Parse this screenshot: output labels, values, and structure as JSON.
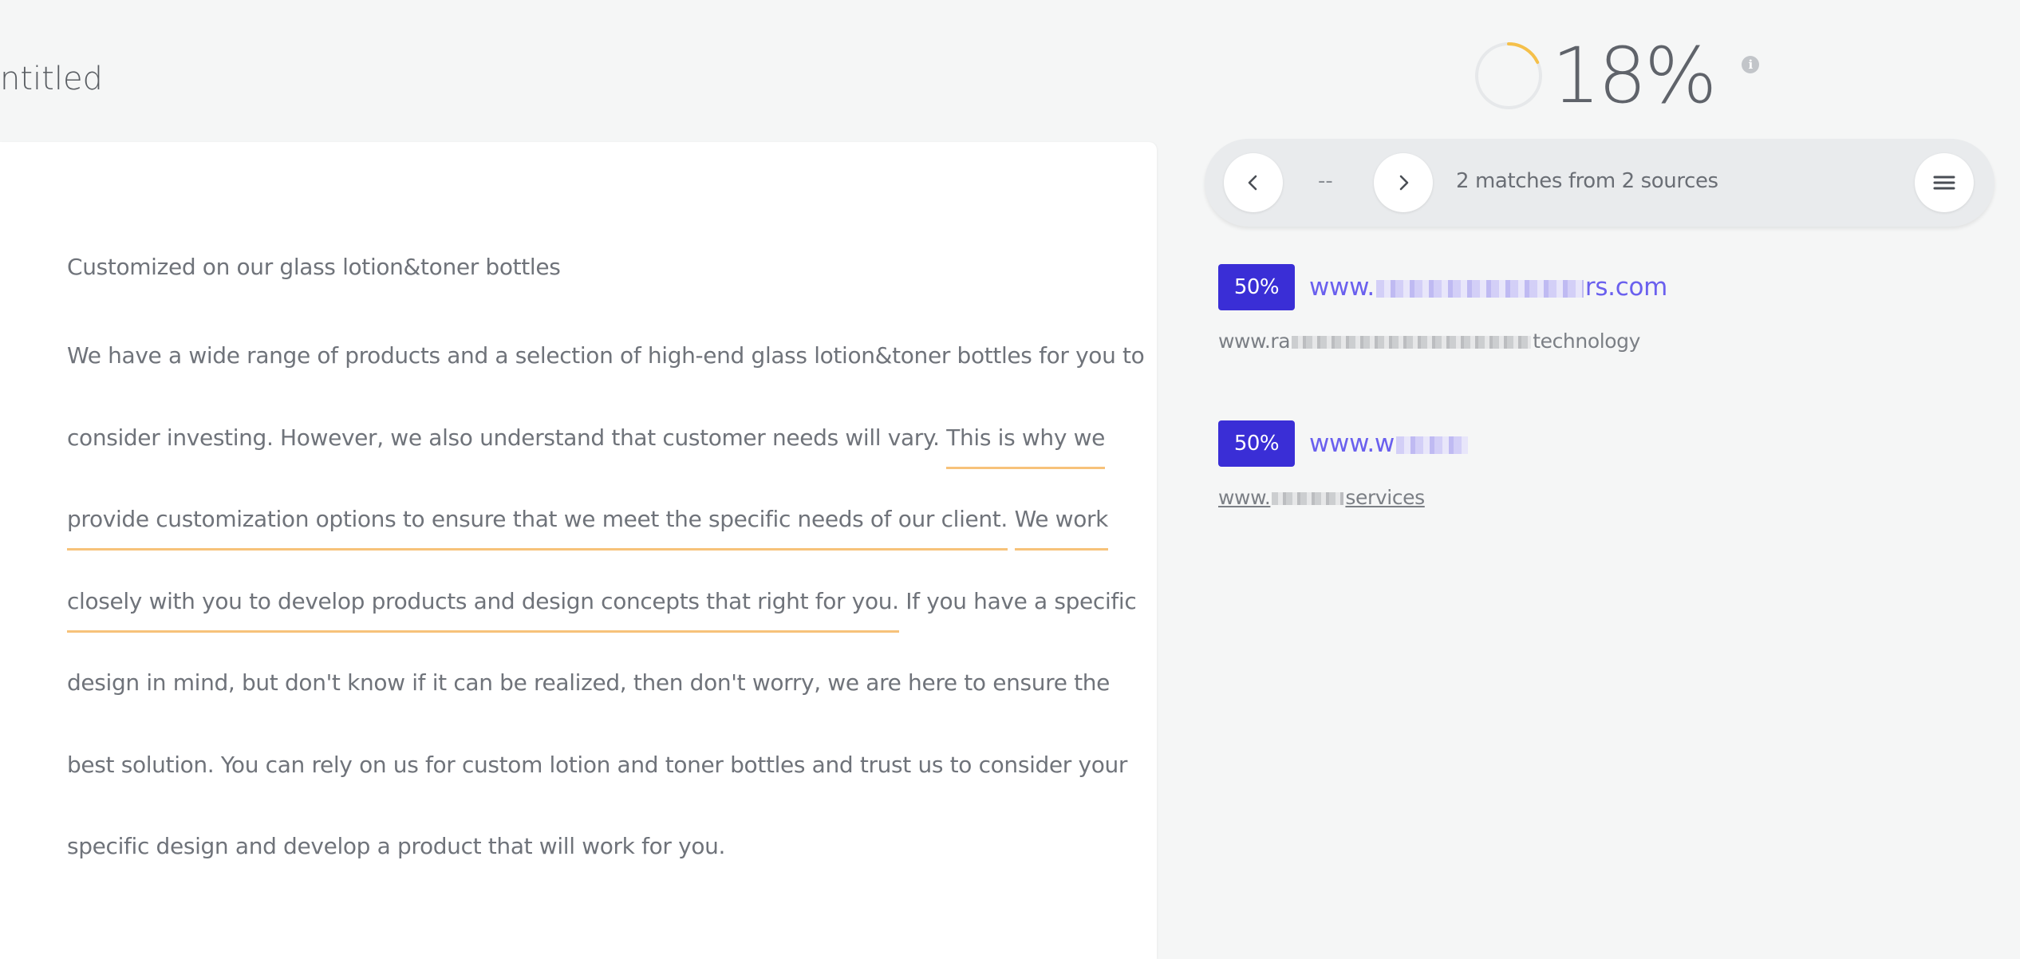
{
  "document": {
    "title": "ntitled",
    "heading": "Customized on our glass lotion&toner bottles",
    "lines": [
      [
        {
          "t": "We have a wide range of products and a selection of high-end glass lotion&toner bottles for you to",
          "hl": false
        }
      ],
      [
        {
          "t": "consider investing. However, we also understand that customer needs will vary. ",
          "hl": false
        },
        {
          "t": "This is why we",
          "hl": true
        }
      ],
      [
        {
          "t": "provide customization options to ensure that we meet the specific needs of our client.",
          "hl": true
        },
        {
          "t": " ",
          "hl": false
        },
        {
          "t": "We work",
          "hl": true
        }
      ],
      [
        {
          "t": "closely with you to develop products and design concepts that right for you.",
          "hl": true
        },
        {
          "t": " If you have a specific",
          "hl": false
        }
      ],
      [
        {
          "t": "design in mind, but don't know if it can be realized, then don't worry, we are here to ensure the",
          "hl": false
        }
      ],
      [
        {
          "t": "best solution. You can rely on us for custom lotion and toner bottles and trust us to consider your",
          "hl": false
        }
      ],
      [
        {
          "t": "specific design and develop a product that will work for you.",
          "hl": false
        }
      ]
    ]
  },
  "score": {
    "value": "18%",
    "progress": 0.18,
    "ring_color": "#f5c04a",
    "track_color": "#e6e8ea",
    "info_icon": "info-icon",
    "info_glyph": "i"
  },
  "navigator": {
    "prev_icon": "chevron-left-icon",
    "next_icon": "chevron-right-icon",
    "menu_icon": "hamburger-menu-icon",
    "position": "--",
    "summary": "2 matches from 2 sources"
  },
  "sources": [
    {
      "percent": "50%",
      "domain_prefix": "www.",
      "domain_suffix": "rs.com",
      "url_prefix": "www.ra",
      "url_suffix": "technology",
      "linked": false
    },
    {
      "percent": "50%",
      "domain_prefix": "www.w",
      "domain_suffix": "",
      "url_prefix": "www.",
      "url_suffix": "services",
      "linked": true
    }
  ],
  "colors": {
    "badge": "#3a2ed6",
    "link": "#6a60ee",
    "highlight_underline": "#f7c27a"
  }
}
